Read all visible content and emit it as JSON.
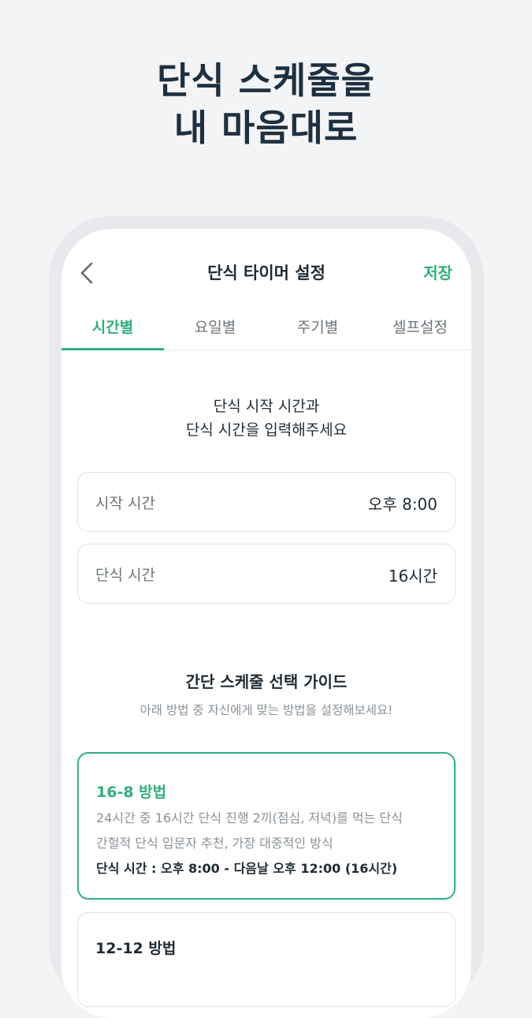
{
  "promo": {
    "line1": "단식 스케줄을",
    "line2": "내 마음대로"
  },
  "appbar": {
    "back_icon": "chevron-left-icon",
    "title": "단식 타이머 설정",
    "save_label": "저장"
  },
  "tabs": [
    {
      "label": "시간별",
      "active": true
    },
    {
      "label": "요일별",
      "active": false
    },
    {
      "label": "주기별",
      "active": false
    },
    {
      "label": "셀프설정",
      "active": false
    }
  ],
  "intro": {
    "line1": "단식 시작 시간과",
    "line2": "단식 시간을 입력해주세요"
  },
  "fields": {
    "start": {
      "label": "시작 시간",
      "value": "오후 8:00"
    },
    "duration": {
      "label": "단식 시간",
      "value": "16시간"
    }
  },
  "guide": {
    "title": "간단 스케줄 선택 가이드",
    "subtitle": "아래 방법 중 자신에게 맞는 방법을 설정해보세요!"
  },
  "cards": [
    {
      "title": "16-8 방법",
      "desc_line1": "24시간 중 16시간 단식 진행 2끼(점심, 저녁)를 먹는 단식",
      "desc_line2": "간헐적 단식 입문자 추천, 가장 대중적인 방식",
      "time": "단식 시간 : 오후 8:00 - 다음날 오후 12:00 (16시간)"
    },
    {
      "title": "12-12 방법"
    }
  ],
  "colors": {
    "accent": "#2fb07c",
    "text": "#1f2b33",
    "muted": "#8a9298",
    "background": "#f3f4f6"
  }
}
